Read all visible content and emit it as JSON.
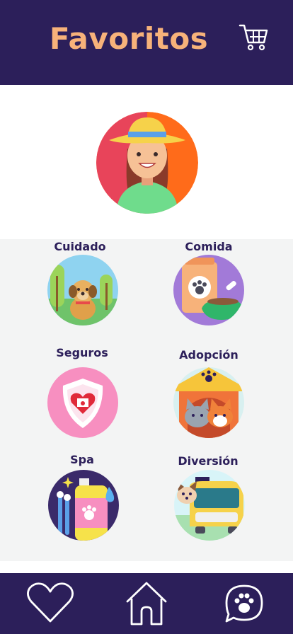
{
  "header": {
    "title": "Favoritos",
    "cart_icon": "cart-icon"
  },
  "profile": {
    "avatar_icon": "woman-with-hat-avatar"
  },
  "categories": [
    {
      "label": "Cuidado",
      "icon": "dog-park-icon"
    },
    {
      "label": "Comida",
      "icon": "pet-food-icon"
    },
    {
      "label": "Seguros",
      "icon": "insurance-shield-icon"
    },
    {
      "label": "Adopción",
      "icon": "adoption-house-icon"
    },
    {
      "label": "Spa",
      "icon": "pet-shampoo-icon"
    },
    {
      "label": "Diversión",
      "icon": "pet-taxi-icon"
    }
  ],
  "nav": {
    "items": [
      "heart-icon",
      "home-icon",
      "paw-chat-icon"
    ]
  },
  "colors": {
    "primary": "#2c1f5a",
    "accent": "#f7b27a",
    "grid_bg": "#f3f4f4"
  }
}
